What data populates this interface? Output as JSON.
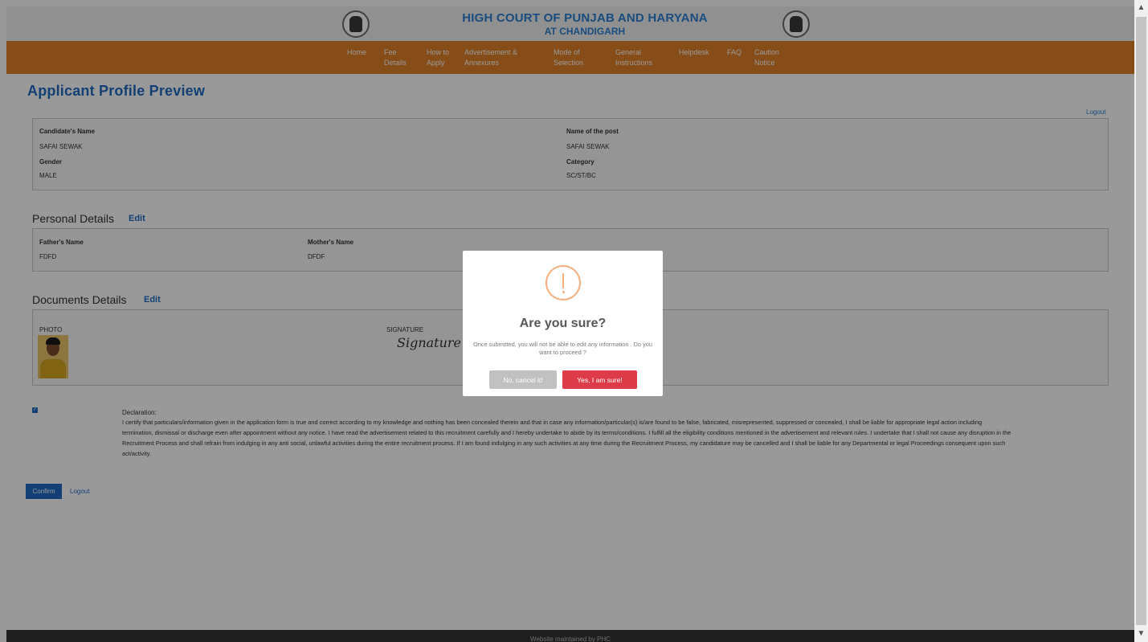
{
  "header": {
    "title_line1": "HIGH COURT OF PUNJAB AND HARYANA",
    "title_line2": "AT CHANDIGARH"
  },
  "nav": {
    "items": [
      {
        "line1": "Home",
        "line2": ""
      },
      {
        "line1": "Fee",
        "line2": "Details"
      },
      {
        "line1": "How to",
        "line2": "Apply"
      },
      {
        "line1": "Advertisement &",
        "line2": "Annexures"
      },
      {
        "line1": "Mode of",
        "line2": "Selection"
      },
      {
        "line1": "General",
        "line2": "Instructions"
      },
      {
        "line1": "Helpdesk",
        "line2": ""
      },
      {
        "line1": "FAQ",
        "line2": ""
      },
      {
        "line1": "Caution",
        "line2": "Notice"
      }
    ]
  },
  "page": {
    "title": "Applicant Profile Preview",
    "logout_label": "Logout"
  },
  "profile": {
    "candidate_name_label": "Candidate's Name",
    "candidate_name": "SAFAI SEWAK",
    "post_label": "Name of the post",
    "post": "SAFAI SEWAK",
    "gender_label": "Gender",
    "gender": "MALE",
    "category_label": "Category",
    "category": "SC/ST/BC"
  },
  "personal": {
    "heading": "Personal Details",
    "edit_label": "Edit",
    "father_label": "Father's Name",
    "father": "FDFD",
    "mother_label": "Mother's Name",
    "mother": "DFDF"
  },
  "documents": {
    "heading": "Documents Details",
    "edit_label": "Edit",
    "photo_label": "PHOTO",
    "signature_label": "SIGNATURE",
    "signature_text": "Signature"
  },
  "declaration": {
    "checked": true,
    "title": "Declaration:",
    "text": "I certify that particulars/information given in the application form is true and correct according to my knowledge and nothing has been concealed therein and that in case any information/particular(s) is/are found to be false, fabricated, misrepresented, suppressed or concealed, I shall be liable for appropriate legal action including termination, dismissal or discharge even after appointment without any notice. I have read the advertisement related to this recruitment carefully and I hereby undertake to abide by its terms/conditions. I fulfill all the eligibility conditions mentioned in the advertisement and relevant rules. I undertake that I shall not cause any disruption in the Recruitment Process and shall refrain from indulging in any anti social, unlawful activities during the entire recruitment process. If I am found indulging in any such activities at any time during the Recruitment Process, my candidature may be cancelled and I shall be liable for any Departmental or legal Proceedings consequent upon such act/activity."
  },
  "actions": {
    "confirm_label": "Confirm",
    "logout_label": "Logout"
  },
  "footer": {
    "text": "Website maintained by PHC"
  },
  "modal": {
    "icon": "warning-icon",
    "title": "Are you sure?",
    "text": "Once submitted, you will not be able to edit any information . Do you want to proceed ?",
    "cancel_label": "No, cancel it!",
    "confirm_label": "Yes, I am sure!"
  },
  "colors": {
    "nav_bg": "#e0812a",
    "title_blue": "#1e6cc4",
    "confirm_red": "#dd3b48",
    "cancel_grey": "#c1c1c1",
    "warning_orange": "#f4ad7c"
  }
}
